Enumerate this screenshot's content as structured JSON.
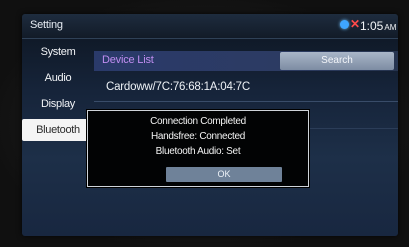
{
  "window": {
    "title": "Setting"
  },
  "status": {
    "time": "1:05",
    "ampm": "AM"
  },
  "sidebar": {
    "items": [
      {
        "label": "System"
      },
      {
        "label": "Audio"
      },
      {
        "label": "Display"
      },
      {
        "label": "Bluetooth",
        "active": true
      }
    ]
  },
  "device_list": {
    "title": "Device List",
    "search_label": "Search",
    "devices": [
      {
        "name": "Cardoww/7C:76:68:1A:04:7C"
      }
    ]
  },
  "dialog": {
    "line1": "Connection Completed",
    "line2": "Handsfree: Connected",
    "line3": "Bluetooth Audio: Set",
    "ok_label": "OK"
  },
  "colors": {
    "accent_purple": "#c08df0",
    "bluetooth_blue": "#3ea5ff",
    "error_red": "#ff4a4a",
    "button_gray": "#6f8299"
  },
  "icons": {
    "bluetooth_status": "bluetooth-indicator-icon",
    "disconnected": "disconnected-x-icon"
  }
}
